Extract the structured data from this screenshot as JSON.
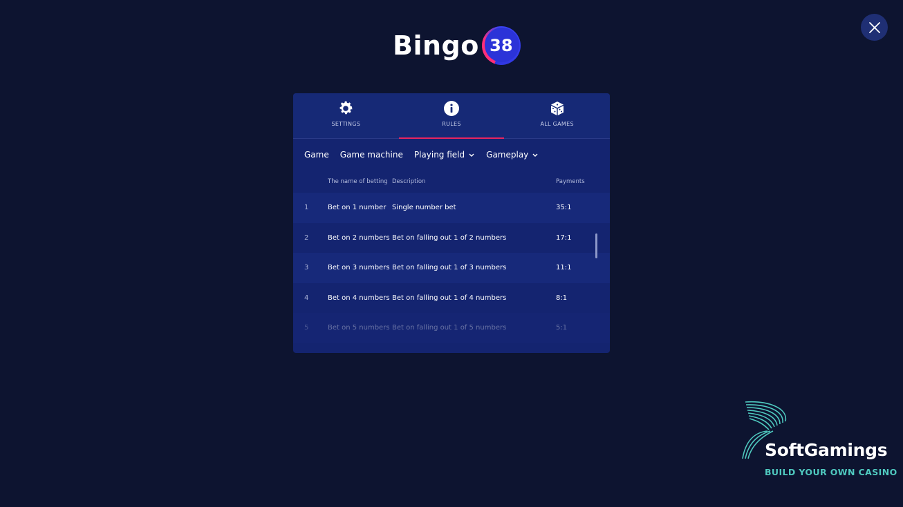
{
  "logo": {
    "text": "Bingo",
    "badge": "38"
  },
  "tabs": [
    {
      "label": "SETTINGS",
      "icon": "gear-icon",
      "active": false
    },
    {
      "label": "RULES",
      "icon": "info-icon",
      "active": true
    },
    {
      "label": "ALL GAMES",
      "icon": "dice-icon",
      "active": false
    }
  ],
  "subnav": [
    {
      "label": "Game"
    },
    {
      "label": "Game machine"
    },
    {
      "label": "Playing field",
      "dropdown": true
    },
    {
      "label": "Gameplay",
      "dropdown": true
    }
  ],
  "table": {
    "headers": {
      "num": "",
      "name": "The name of betting",
      "desc": "Description",
      "pay": "Payments"
    },
    "rows": [
      {
        "num": "1",
        "name": "Bet on 1 number",
        "desc": "Single number bet",
        "pay": "35:1"
      },
      {
        "num": "2",
        "name": "Bet on 2 numbers",
        "desc": "Bet on falling out 1 of 2 numbers",
        "pay": "17:1"
      },
      {
        "num": "3",
        "name": "Bet on 3 numbers",
        "desc": "Bet on falling out 1 of 3 numbers",
        "pay": "11:1"
      },
      {
        "num": "4",
        "name": "Bet on 4 numbers",
        "desc": "Bet on falling out 1 of 4 numbers",
        "pay": "8:1"
      },
      {
        "num": "5",
        "name": "Bet on 5 numbers",
        "desc": "Bet on falling out 1 of 5 numbers",
        "pay": "5:1"
      }
    ]
  },
  "brand": {
    "name": "SoftGamings",
    "tagline": "BUILD YOUR OWN CASINO"
  },
  "colors": {
    "background": "#0d1430",
    "panel": "#142470",
    "accent": "#e8245f",
    "brand_teal": "#4fc9bf"
  }
}
